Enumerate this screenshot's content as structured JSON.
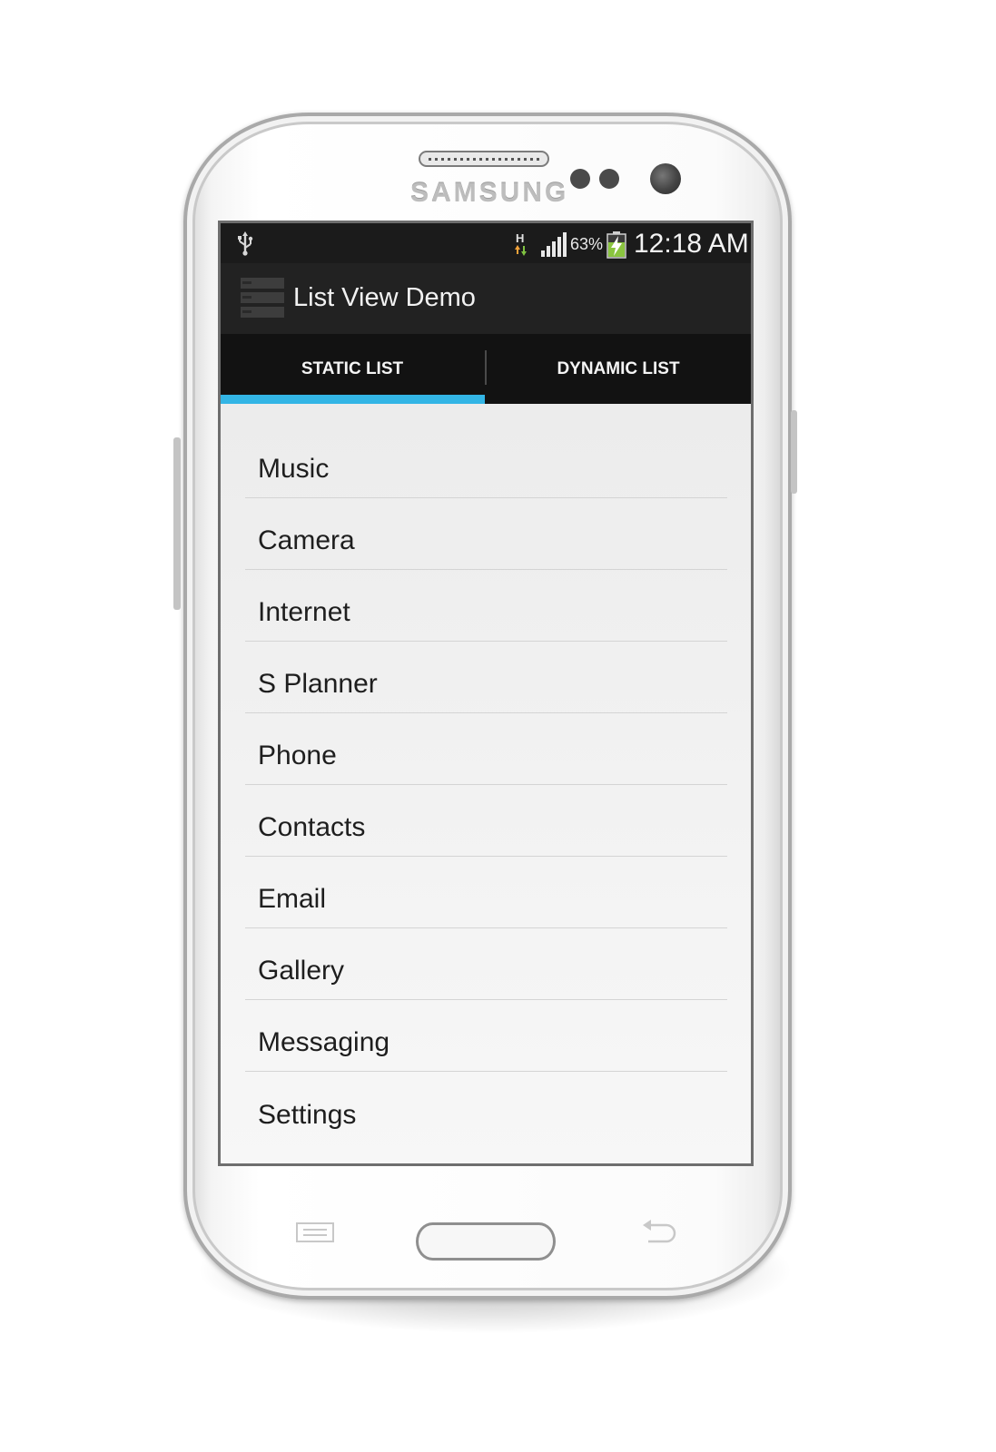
{
  "device": {
    "brand": "SAMSUNG"
  },
  "status_bar": {
    "icons": [
      "usb-icon",
      "hspa-data-icon",
      "signal-icon",
      "battery-charging-icon"
    ],
    "network_type": "H",
    "battery_percent": "63%",
    "time": "12:18 AM"
  },
  "action_bar": {
    "app_icon": "list-app-icon",
    "title": "List View Demo"
  },
  "tabs": [
    {
      "label": "STATIC LIST",
      "selected": true
    },
    {
      "label": "DYNAMIC LIST",
      "selected": false
    }
  ],
  "list": {
    "items": [
      {
        "label": "Music"
      },
      {
        "label": "Camera"
      },
      {
        "label": "Internet"
      },
      {
        "label": "S Planner"
      },
      {
        "label": "Phone"
      },
      {
        "label": "Contacts"
      },
      {
        "label": "Email"
      },
      {
        "label": "Gallery"
      },
      {
        "label": "Messaging"
      },
      {
        "label": "Settings"
      }
    ]
  },
  "hardware_keys": {
    "icons": [
      "menu-key-icon",
      "home-button",
      "back-key-icon"
    ]
  },
  "colors": {
    "tab_indicator": "#33b5e5",
    "action_bar": "#222222",
    "status_bar": "#1b1b1b",
    "list_background": "#efefef"
  }
}
